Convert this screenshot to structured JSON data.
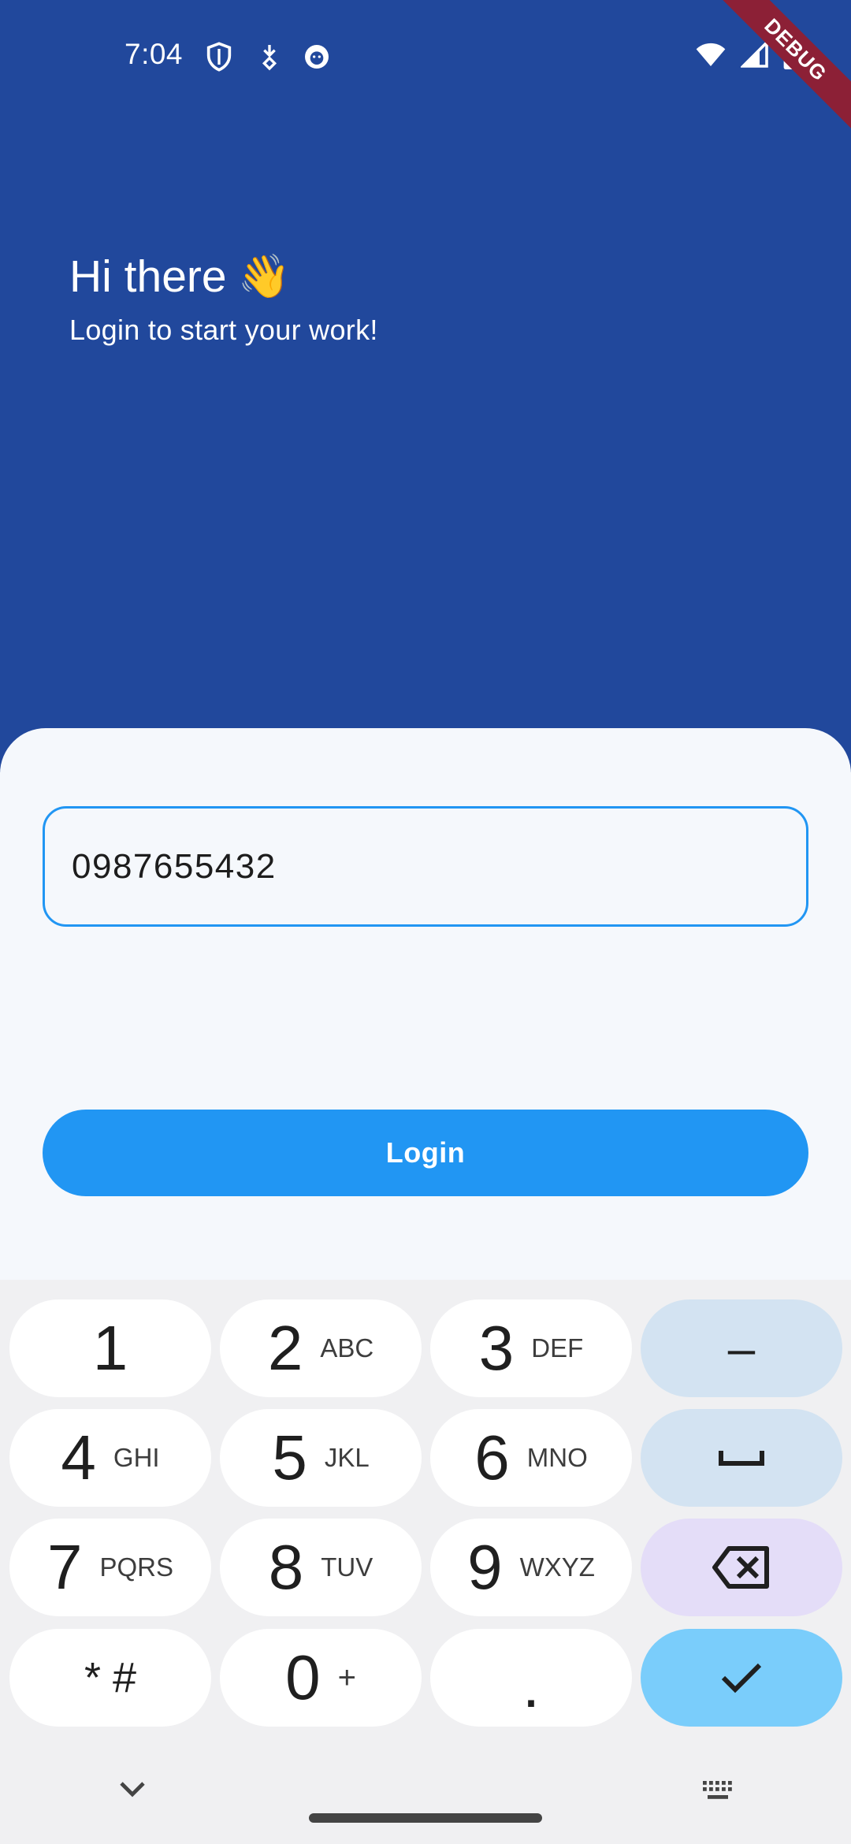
{
  "status_bar": {
    "time": "7:04",
    "icons": [
      "shield-icon",
      "download-icon",
      "notification-app-icon"
    ],
    "right_icons": [
      "wifi-icon",
      "signal-icon",
      "battery-icon"
    ]
  },
  "debug_banner": "DEBUG",
  "header": {
    "greeting": "Hi there",
    "wave": "👋",
    "subtitle": "Login to start your work!"
  },
  "form": {
    "phone_value": "0987655432",
    "login_label": "Login"
  },
  "colors": {
    "primary_dark": "#21489c",
    "accent": "#2196f3",
    "debug": "#8c2036"
  },
  "keyboard": {
    "rows": [
      [
        {
          "digit": "1",
          "letters": ""
        },
        {
          "digit": "2",
          "letters": "ABC"
        },
        {
          "digit": "3",
          "letters": "DEF"
        },
        {
          "digit": "–",
          "letters": ""
        }
      ],
      [
        {
          "digit": "4",
          "letters": "GHI"
        },
        {
          "digit": "5",
          "letters": "JKL"
        },
        {
          "digit": "6",
          "letters": "MNO"
        },
        {
          "digit": "␣",
          "letters": ""
        }
      ],
      [
        {
          "digit": "7",
          "letters": "PQRS"
        },
        {
          "digit": "8",
          "letters": "TUV"
        },
        {
          "digit": "9",
          "letters": "WXYZ"
        },
        {
          "digit": "⌫",
          "letters": ""
        }
      ],
      [
        {
          "digit": "* #",
          "letters": ""
        },
        {
          "digit": "0",
          "letters": "+"
        },
        {
          "digit": ".",
          "letters": ""
        },
        {
          "digit": "✓",
          "letters": ""
        }
      ]
    ]
  },
  "nav": {
    "icons": [
      "chevron-down-icon",
      "keyboard-icon"
    ]
  }
}
